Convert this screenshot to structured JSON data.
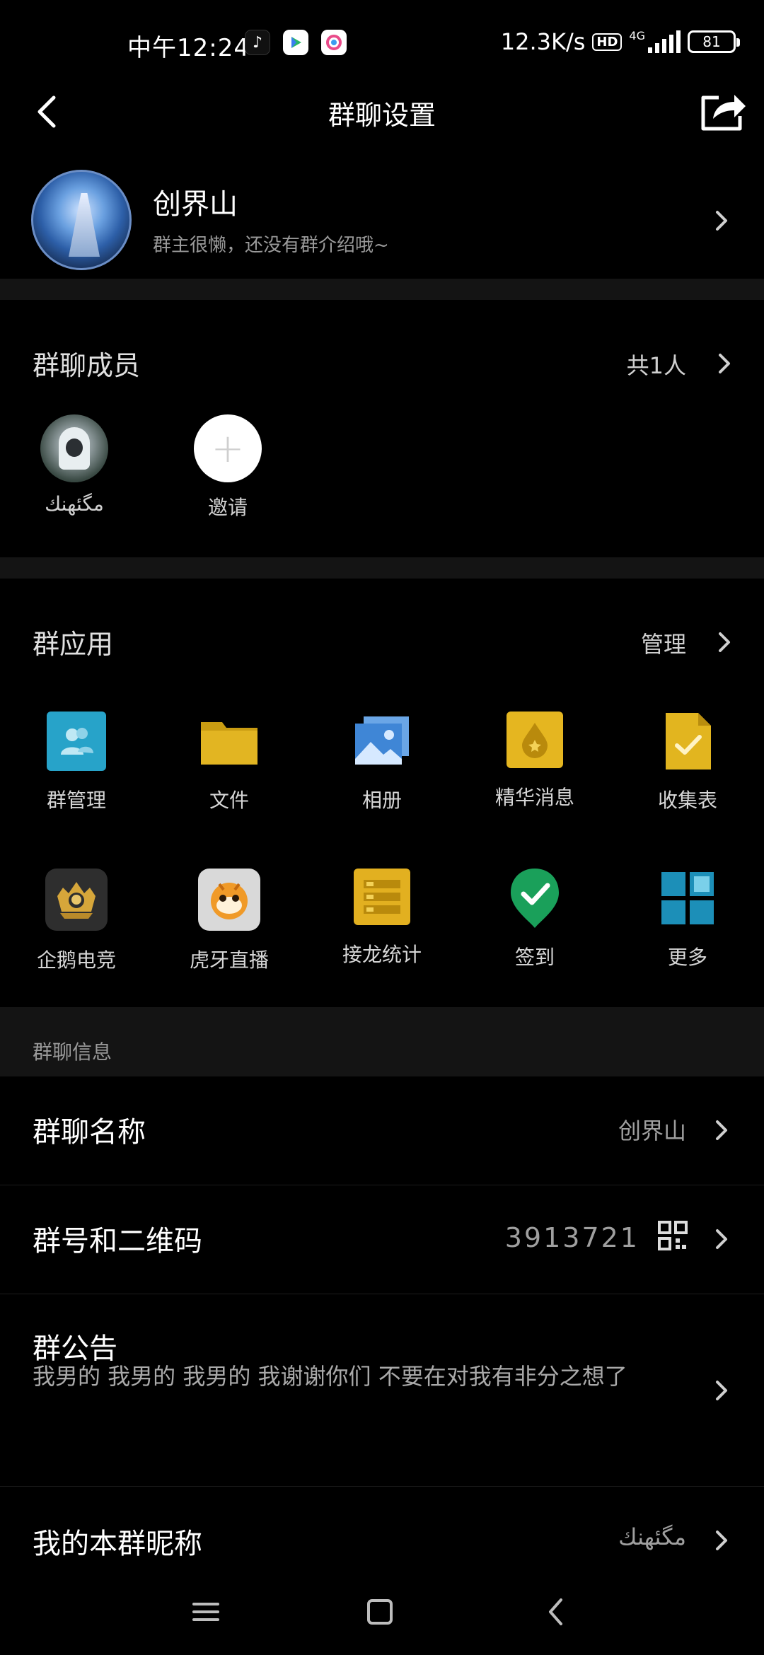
{
  "status_bar": {
    "time": "中午12:24",
    "net_speed": "12.3K/s",
    "hd": "HD",
    "network": "4G",
    "battery": "81"
  },
  "header": {
    "title": "群聊设置"
  },
  "group": {
    "name": "创界山",
    "description": "群主很懒，还没有群介绍哦~"
  },
  "members": {
    "title": "群聊成员",
    "count": "共1人",
    "list": [
      {
        "label": "مگئهنك"
      },
      {
        "label": "邀请"
      }
    ]
  },
  "apps": {
    "title": "群应用",
    "manage": "管理",
    "items": [
      {
        "label": "群管理",
        "icon": "group-manage-icon",
        "color": "#27a3c9"
      },
      {
        "label": "文件",
        "icon": "folder-icon",
        "color": "#e0b623"
      },
      {
        "label": "相册",
        "icon": "album-icon",
        "color": "#4a8fd9"
      },
      {
        "label": "精华消息",
        "icon": "essence-icon",
        "color": "#e5b620"
      },
      {
        "label": "收集表",
        "icon": "collect-form-icon",
        "color": "#e2b51f"
      },
      {
        "label": "企鹅电竞",
        "icon": "penguin-esports-icon",
        "color": "#2e2e2e"
      },
      {
        "label": "虎牙直播",
        "icon": "huya-live-icon",
        "color": "#f0a02a"
      },
      {
        "label": "接龙统计",
        "icon": "chain-stats-icon",
        "color": "#e2b020"
      },
      {
        "label": "签到",
        "icon": "checkin-icon",
        "color": "#1aa05a"
      },
      {
        "label": "更多",
        "icon": "more-apps-icon",
        "color": "#1c8fb8"
      }
    ]
  },
  "info": {
    "header": "群聊信息",
    "name_label": "群聊名称",
    "name_value": "创界山",
    "number_label": "群号和二维码",
    "number_value": "3913721",
    "notice_label": "群公告",
    "notice_text": "我男的 我男的 我男的 我谢谢你们 不要在对我有非分之想了",
    "nickname_label": "我的本群昵称",
    "nickname_value": "مگئهنك"
  }
}
